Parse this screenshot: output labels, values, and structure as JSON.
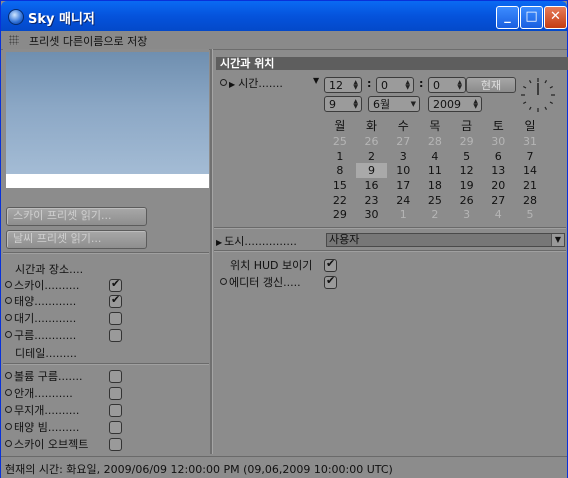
{
  "window": {
    "title": "Sky 매니저",
    "min_glyph": "_",
    "max_glyph": "□",
    "close_glyph": "✕"
  },
  "menu": {
    "save_preset_as": "프리셋 다른이름으로 저장"
  },
  "left": {
    "load_sky_preset": "스카이 프리셋 읽기...",
    "load_weather_preset": "날씨 프리셋 읽기...",
    "time_and_place": "시간과 장소....",
    "items_top": [
      {
        "label": "스카이..........",
        "dot": true,
        "checked": true
      },
      {
        "label": "태양............",
        "dot": true,
        "checked": true
      },
      {
        "label": "대기............",
        "dot": true,
        "checked": false
      },
      {
        "label": "구름............",
        "dot": true,
        "checked": false
      }
    ],
    "detail": "디테일.........",
    "items_bottom": [
      {
        "label": "볼륨 구름.......",
        "checked": false
      },
      {
        "label": "안개...........",
        "checked": false
      },
      {
        "label": "무지개..........",
        "checked": false
      },
      {
        "label": "태양 빔.........",
        "checked": false
      },
      {
        "label": "스카이 오브젝트",
        "checked": false
      }
    ]
  },
  "right": {
    "section_title": "시간과 위치",
    "time_label": "시간.......",
    "hour": "12",
    "minute": "0",
    "second": "0",
    "now_button": "현재",
    "day": "9",
    "month": "6월",
    "year": "2009",
    "weekdays": [
      "월",
      "화",
      "수",
      "목",
      "금",
      "토",
      "일"
    ],
    "weeks": [
      [
        "25",
        "26",
        "27",
        "28",
        "29",
        "30",
        "31"
      ],
      [
        "1",
        "2",
        "3",
        "4",
        "5",
        "6",
        "7"
      ],
      [
        "8",
        "9",
        "10",
        "11",
        "12",
        "13",
        "14"
      ],
      [
        "15",
        "16",
        "17",
        "18",
        "19",
        "20",
        "21"
      ],
      [
        "22",
        "23",
        "24",
        "25",
        "26",
        "27",
        "28"
      ],
      [
        "29",
        "30",
        "1",
        "2",
        "3",
        "4",
        "5"
      ]
    ],
    "city_label": "도시...............",
    "city_value": "사용자",
    "hud_label": "위치 HUD 보이기",
    "editor_update_label": "에디터 갱신.....",
    "hud_checked": true,
    "editor_update_checked": true
  },
  "status": {
    "text": "현재의 시간: 화요일, 2009/06/09  12:00:00 PM  (09,06,2009  10:00:00 UTC)"
  },
  "colors": {
    "panel": "#8c8c8c",
    "titlebar": "#0553dc",
    "section_header": "#5e5e5e"
  }
}
